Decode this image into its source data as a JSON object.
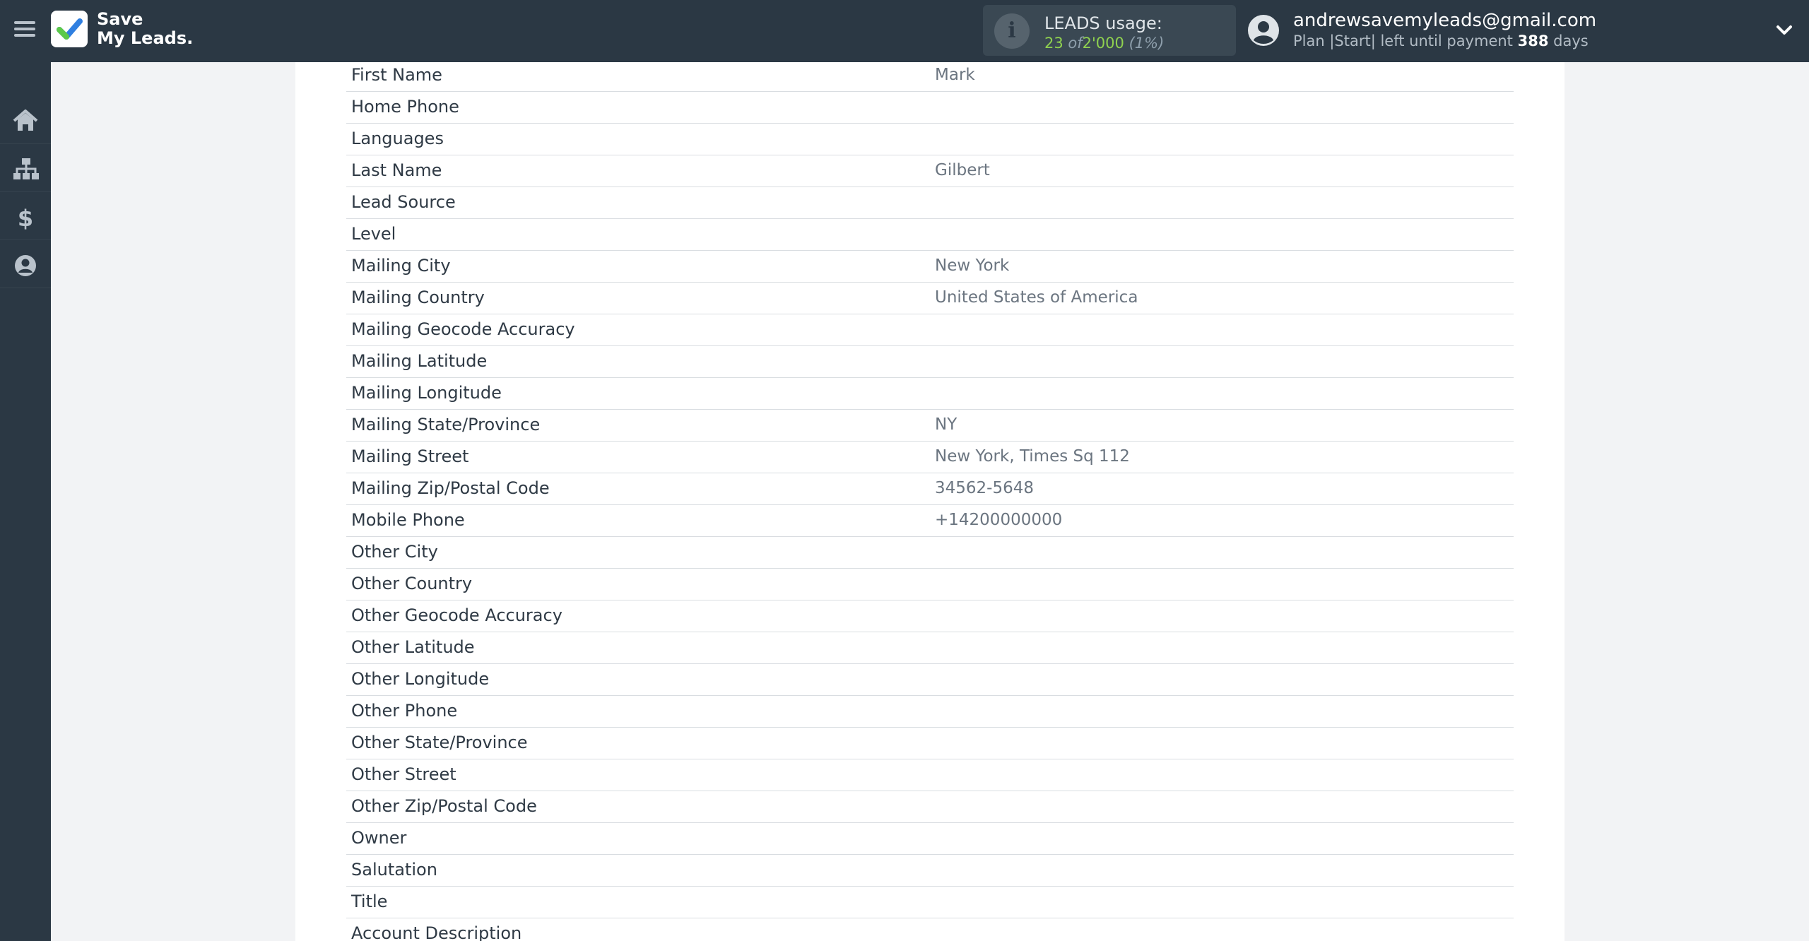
{
  "app": {
    "logo_line1": "Save",
    "logo_line2": "My Leads."
  },
  "usage": {
    "title": "LEADS usage:",
    "used": "23",
    "of": "of",
    "total": "2'000",
    "percent": "(1%)"
  },
  "user": {
    "email": "andrewsavemyleads@gmail.com",
    "plan_prefix": "Plan |Start| left until payment",
    "days_count": "388",
    "days_label": "days"
  },
  "sidebar": {
    "items": [
      {
        "icon": "home-icon"
      },
      {
        "icon": "sitemap-icon"
      },
      {
        "icon": "dollar-icon"
      },
      {
        "icon": "user-circle-icon"
      }
    ]
  },
  "fields": [
    {
      "name": "First Name",
      "value": "Mark"
    },
    {
      "name": "Home Phone",
      "value": ""
    },
    {
      "name": "Languages",
      "value": ""
    },
    {
      "name": "Last Name",
      "value": "Gilbert"
    },
    {
      "name": "Lead Source",
      "value": ""
    },
    {
      "name": "Level",
      "value": ""
    },
    {
      "name": "Mailing City",
      "value": "New York"
    },
    {
      "name": "Mailing Country",
      "value": "United States of America"
    },
    {
      "name": "Mailing Geocode Accuracy",
      "value": ""
    },
    {
      "name": "Mailing Latitude",
      "value": ""
    },
    {
      "name": "Mailing Longitude",
      "value": ""
    },
    {
      "name": "Mailing State/Province",
      "value": "NY"
    },
    {
      "name": "Mailing Street",
      "value": "New York, Times Sq 112"
    },
    {
      "name": "Mailing Zip/Postal Code",
      "value": "34562-5648"
    },
    {
      "name": "Mobile Phone",
      "value": "+14200000000"
    },
    {
      "name": "Other City",
      "value": ""
    },
    {
      "name": "Other Country",
      "value": ""
    },
    {
      "name": "Other Geocode Accuracy",
      "value": ""
    },
    {
      "name": "Other Latitude",
      "value": ""
    },
    {
      "name": "Other Longitude",
      "value": ""
    },
    {
      "name": "Other Phone",
      "value": ""
    },
    {
      "name": "Other State/Province",
      "value": ""
    },
    {
      "name": "Other Street",
      "value": ""
    },
    {
      "name": "Other Zip/Postal Code",
      "value": ""
    },
    {
      "name": "Owner",
      "value": ""
    },
    {
      "name": "Salutation",
      "value": ""
    },
    {
      "name": "Title",
      "value": ""
    },
    {
      "name": "Account Description",
      "value": ""
    }
  ]
}
